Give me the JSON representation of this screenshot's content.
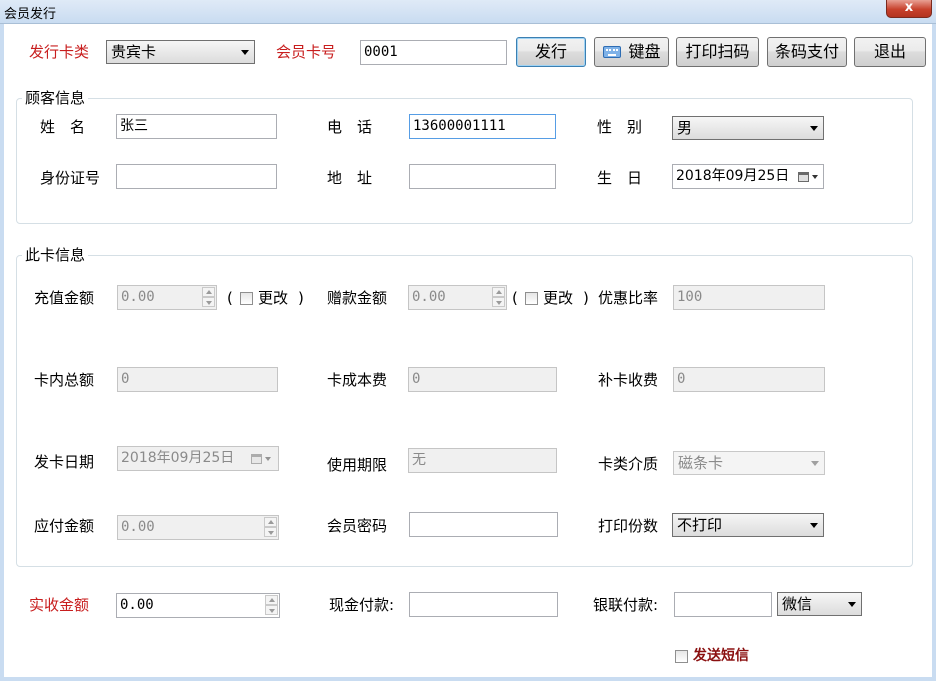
{
  "window": {
    "title": "会员发行",
    "close_label": "x"
  },
  "top": {
    "card_type_label": "发行卡类",
    "card_type_value": "贵宾卡",
    "card_no_label": "会员卡号",
    "card_no_value": "0001",
    "buttons": {
      "issue": "发行",
      "keyboard": "键盘",
      "print_scan": "打印扫码",
      "barcode_pay": "条码支付",
      "exit": "退出"
    }
  },
  "customer": {
    "group_title": "顾客信息",
    "name_label": "姓　名",
    "name_value": "张三",
    "phone_label": "电　话",
    "phone_value": "13600001111",
    "gender_label": "性　别",
    "gender_value": "男",
    "id_label": "身份证号",
    "id_value": "",
    "address_label": "地　址",
    "address_value": "",
    "birthday_label": "生　日",
    "birthday_value": "2018年09月25日"
  },
  "card": {
    "group_title": "此卡信息",
    "recharge_label": "充值金额",
    "recharge_value": "0.00",
    "recharge_change_open": "(",
    "recharge_change_label": "更改",
    "recharge_change_close": ")",
    "bonus_label": "赠款金额",
    "bonus_value": "0.00",
    "bonus_change_open": "(",
    "bonus_change_label": "更改",
    "bonus_change_close": ")",
    "discount_label": "优惠比率",
    "discount_value": "100",
    "total_label": "卡内总额",
    "total_value": "0",
    "cost_label": "卡成本费",
    "cost_value": "0",
    "reissue_label": "补卡收费",
    "reissue_value": "0",
    "issue_date_label": "发卡日期",
    "issue_date_value": "2018年09月25日",
    "validity_label": "使用期限",
    "validity_value": "无",
    "medium_label": "卡类介质",
    "medium_value": "磁条卡",
    "payable_label": "应付金额",
    "payable_value": "0.00",
    "password_label": "会员密码",
    "password_value": "",
    "copies_label": "打印份数",
    "copies_value": "不打印"
  },
  "payment": {
    "received_label": "实收金额",
    "received_value": "0.00",
    "cash_label": "现金付款:",
    "cash_value": "",
    "unionpay_label": "银联付款:",
    "unionpay_value": "",
    "method_value": "微信",
    "sms_label": "发送短信"
  }
}
